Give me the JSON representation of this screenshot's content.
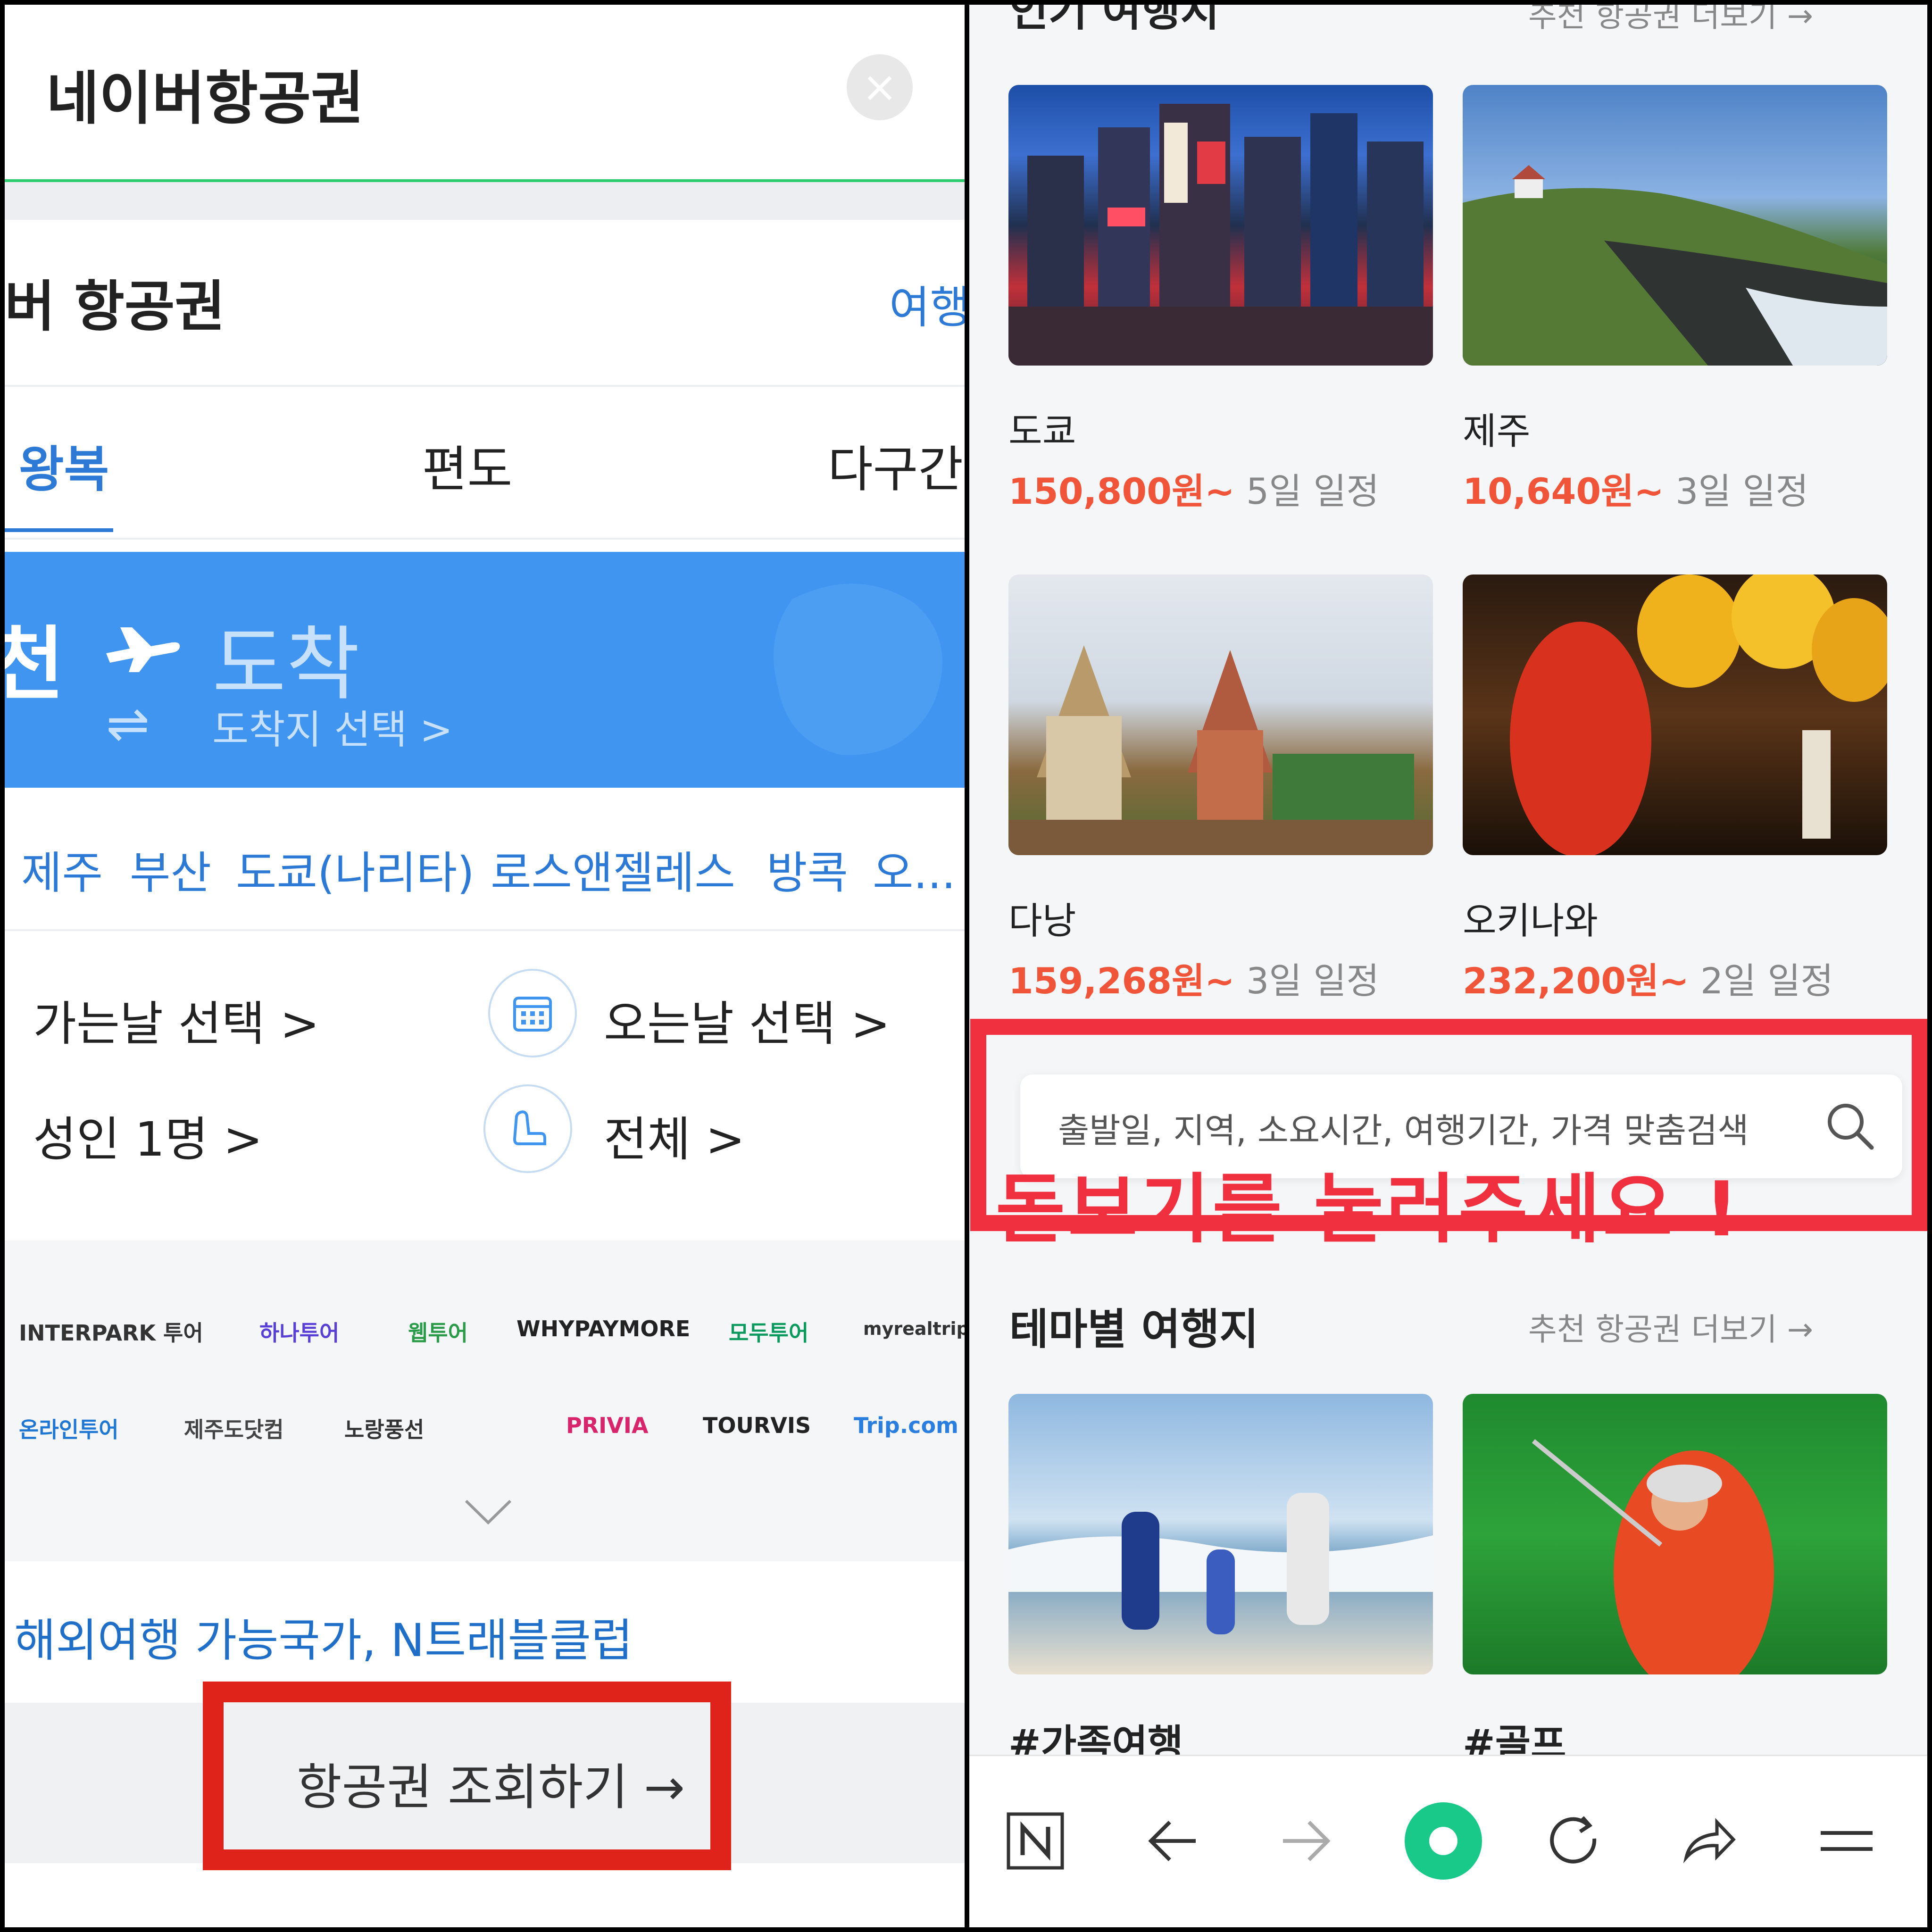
{
  "left": {
    "header": {
      "title": "네이버항공권",
      "close_label": "×"
    },
    "sub_header": {
      "title": "버 항공권",
      "link": "여행"
    },
    "tabs": [
      {
        "label": "왕복"
      },
      {
        "label": "편도"
      },
      {
        "label": "다구간"
      }
    ],
    "route": {
      "departure": "천",
      "arrival": "도착",
      "arrival_hint": "도착지 선택 >"
    },
    "quick_destinations": [
      "제주",
      "부산",
      "도쿄(나리타)",
      "로스앤젤레스",
      "방콕",
      "오..."
    ],
    "date_go": "가는날 선택 >",
    "date_return": "오는날 선택 >",
    "passengers": "성인 1명 >",
    "seat_class": "전체 >",
    "agencies_row1": [
      "INTERPARK 투어",
      "하나투어",
      "웹투어",
      "WHYPAYMORE",
      "모두투어",
      "myrealtrip"
    ],
    "agencies_row2": [
      "온라인투어",
      "제주도닷컴",
      "노랑풍선",
      "PRIVIA",
      "TOURVIS",
      "Trip.com"
    ],
    "promo": "해외여행 가능국가, N트래블클럽",
    "search_button": "항공권 조회하기 →"
  },
  "right": {
    "popular": {
      "title": "인기 여행지",
      "more": "추천 항공권 더보기 →"
    },
    "cards": [
      {
        "name": "도쿄",
        "price": "150,800원~",
        "days": "5일 일정"
      },
      {
        "name": "제주",
        "price": "10,640원~",
        "days": "3일 일정"
      },
      {
        "name": "다낭",
        "price": "159,268원~",
        "days": "3일 일정"
      },
      {
        "name": "오키나와",
        "price": "232,200원~",
        "days": "2일 일정"
      }
    ],
    "search_placeholder": "출발일, 지역, 소요시간, 여행기간, 가격 맞춤검색",
    "callout_text": "돋보기를 눌러주세요 !",
    "theme": {
      "title": "테마별 여행지",
      "more": "추천 항공권 더보기 →"
    },
    "theme_tags": [
      "#가족여행",
      "#골프"
    ],
    "nav": [
      "naver-home",
      "back",
      "forward",
      "green-dot",
      "refresh",
      "share",
      "menu"
    ]
  },
  "colors": {
    "accent_blue": "#3f95f0",
    "naver_green": "#2ecc71",
    "price_orange": "#f0553a",
    "annotation_red": "#e0231a"
  }
}
